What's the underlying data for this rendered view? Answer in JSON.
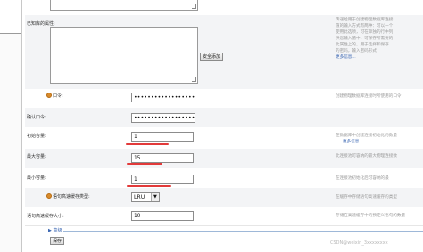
{
  "form": {
    "rows": [
      {
        "id": "sql",
        "label": "已知库的属性:"
      },
      {
        "id": "password",
        "label": "口令:",
        "value": "••••••••••••••••••",
        "desc": "创建物理数据库连接时所使用的口令"
      },
      {
        "id": "confirm",
        "label": "确认口令:",
        "value": "••••••••••••••••••"
      },
      {
        "id": "initial",
        "label": "初始容量:",
        "value": "1",
        "desc": "在数据库中创建连接初始化的数量",
        "more": "更多信息..."
      },
      {
        "id": "max",
        "label": "最大容量:",
        "value": "15",
        "desc": "此连接池可容纳的最大物理连接数"
      },
      {
        "id": "min",
        "label": "最小容量:",
        "value": "1",
        "desc": "在连接池初始化后可容纳的最"
      },
      {
        "id": "cache_type",
        "label": "语句高速缓存类型:",
        "value": "LRU",
        "desc": "在缓存中存储语句高速缓存的类型"
      },
      {
        "id": "cache_size",
        "label": "语句高速缓存大小:",
        "value": "10",
        "desc": "存储在高速缓存中的预定义语句的数量"
      }
    ],
    "props_desc_lines": [
      "传递给用于创建物理数据库连接",
      "值的输入方式有两种：可以一个",
      "使用此选项，可在单独的行中列",
      "供您输入值中，可保存所需要的",
      "此属性上的，用于选择和保存",
      "的密码，输入密码形式"
    ],
    "props_more": "更多信息...",
    "secure_button": "安全添加",
    "advanced_label": "高级",
    "save_button": "保存",
    "watermark": "CSDN@weixin_3xxxxxxxx"
  }
}
